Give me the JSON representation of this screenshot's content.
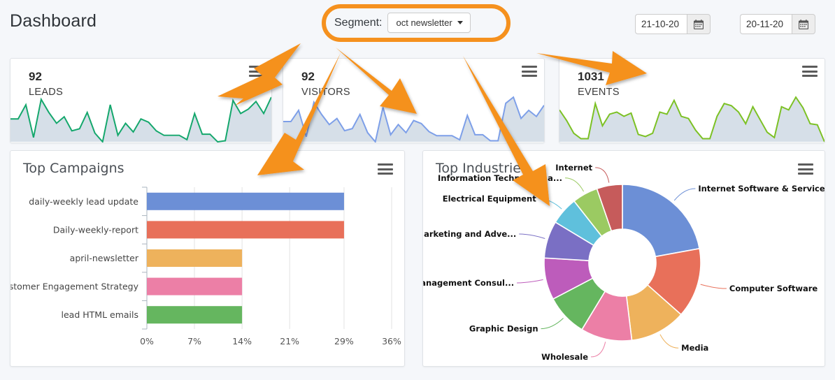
{
  "header": {
    "title": "Dashboard",
    "segment_label": "Segment:",
    "segment_value": "oct newsletter",
    "date_from": "21-10-20",
    "date_to": "20-11-20",
    "calendar_icon": "calendar-icon",
    "caret_icon": "chevron-down-icon",
    "highlight_color": "#F5911E"
  },
  "stats": [
    {
      "value": "92",
      "label": "LEADS",
      "color": "#14a76c",
      "fill": "#d6dfe8",
      "points": [
        52,
        52,
        78,
        18,
        88,
        64,
        44,
        56,
        30,
        34,
        64,
        26,
        10,
        78,
        22,
        44,
        28,
        52,
        46,
        30,
        22,
        22,
        22,
        14,
        62,
        24,
        24,
        10,
        12,
        86,
        62,
        70,
        84,
        62,
        92
      ]
    },
    {
      "value": "92",
      "label": "VISITORS",
      "color": "#7d9fe8",
      "fill": "#d6dfe8",
      "points": [
        48,
        48,
        70,
        18,
        86,
        62,
        42,
        54,
        30,
        34,
        62,
        26,
        8,
        76,
        22,
        42,
        26,
        50,
        44,
        28,
        20,
        20,
        20,
        12,
        60,
        22,
        22,
        10,
        10,
        84,
        96,
        54,
        70,
        58,
        80
      ]
    },
    {
      "value": "1031",
      "label": "EVENTS",
      "color": "#7cc124",
      "fill": "#d6dfe8",
      "points": [
        66,
        46,
        22,
        12,
        12,
        78,
        36,
        58,
        62,
        54,
        60,
        20,
        16,
        22,
        62,
        58,
        84,
        54,
        50,
        28,
        12,
        12,
        54,
        78,
        74,
        62,
        40,
        72,
        48,
        24,
        14,
        72,
        66,
        90,
        70,
        40,
        38,
        6
      ]
    }
  ],
  "campaigns": {
    "title": "Top Campaigns",
    "menu_icon": "hamburger-menu-icon"
  },
  "industries": {
    "title": "Top Industries",
    "menu_icon": "hamburger-menu-icon"
  },
  "chart_data": [
    {
      "type": "bar",
      "title": "Top Campaigns",
      "orientation": "horizontal",
      "categories": [
        "daily-weekly lead update",
        "Daily-weekly-report",
        "april-newsletter",
        "Customer Engagement Strategy",
        "lead HTML emails"
      ],
      "values": [
        29,
        29,
        14,
        14,
        14
      ],
      "colors": [
        "#6c8fd6",
        "#e8705a",
        "#eeb25c",
        "#ec7fa6",
        "#65b65f"
      ],
      "xlabel": "",
      "ylabel": "",
      "xlim": [
        0,
        36
      ],
      "ticks": [
        "0%",
        "7%",
        "14%",
        "21%",
        "29%",
        "36%"
      ],
      "tick_values": [
        0,
        7,
        14,
        21,
        29,
        36
      ],
      "grid": true
    },
    {
      "type": "pie",
      "subtype": "donut",
      "title": "Top Industries",
      "labels": [
        "Internet Software & Services",
        "Computer Software",
        "Media",
        "Wholesale",
        "Graphic Design",
        "Management Consul...",
        "Marketing and Adve...",
        "Electrical Equipment",
        "Information Technology a...",
        "Internet"
      ],
      "values": [
        23,
        15,
        12,
        11,
        9,
        9,
        8,
        6,
        5.5,
        5.5
      ],
      "colors": [
        "#6c8fd6",
        "#e8705a",
        "#eeb25c",
        "#ec7fa6",
        "#65b65f",
        "#bd5cbb",
        "#7a6fc4",
        "#5fc0dc",
        "#9bca62",
        "#c65b5b"
      ],
      "legend": "callout-labels",
      "grid": false
    }
  ],
  "annotations": {
    "arrow_color": "#F5911E",
    "arrow_count": 4
  }
}
